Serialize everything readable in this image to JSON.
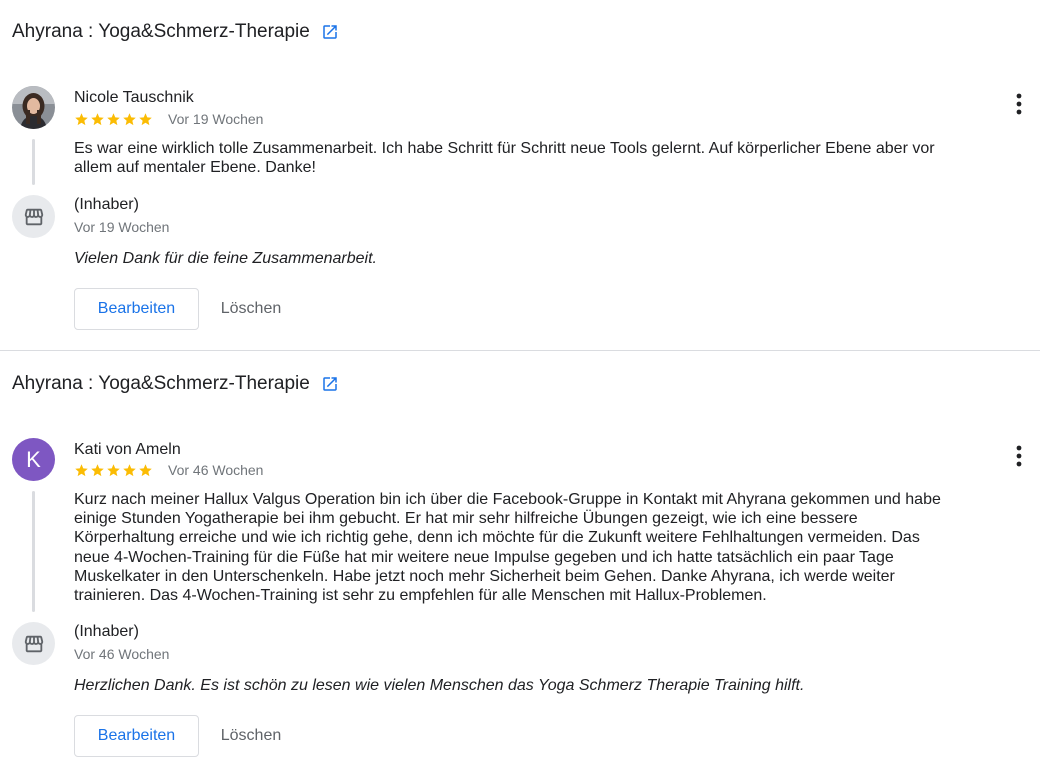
{
  "reviews": [
    {
      "business_title": "Ahyrana : Yoga&Schmerz-Therapie",
      "reviewer_name": "Nicole Tauschnik",
      "avatar_letter": "",
      "rating": 5,
      "date": "Vor 19 Wochen",
      "text": "Es war eine wirklich tolle Zusammenarbeit. Ich habe Schritt für Schritt neue Tools gelernt. Auf körperlicher Ebene aber vor allem auf mentaler Ebene. Danke!",
      "owner_label": "(Inhaber)",
      "owner_date": "Vor 19 Wochen",
      "reply": "Vielen Dank für die feine Zusammenarbeit.",
      "edit_label": "Bearbeiten",
      "delete_label": "Löschen"
    },
    {
      "business_title": "Ahyrana : Yoga&Schmerz-Therapie",
      "reviewer_name": "Kati von Ameln",
      "avatar_letter": "K",
      "rating": 5,
      "date": "Vor 46 Wochen",
      "text": "Kurz nach meiner Hallux Valgus Operation bin ich über die Facebook-Gruppe in Kontakt mit Ahyrana gekommen und habe einige Stunden Yogatherapie bei ihm gebucht. Er hat mir sehr hilfreiche Übungen gezeigt, wie ich eine bessere Körperhaltung erreiche und wie ich richtig gehe, denn ich möchte für die Zukunft weitere Fehlhaltungen vermeiden. Das neue 4-Wochen-Training für die Füße hat mir weitere neue Impulse gegeben und ich hatte tatsächlich ein paar Tage Muskelkater in den Unterschenkeln. Habe jetzt noch mehr Sicherheit beim Gehen. Danke Ahyrana, ich werde weiter trainieren. Das 4-Wochen-Training ist sehr zu empfehlen für alle Menschen mit Hallux-Problemen.",
      "owner_label": "(Inhaber)",
      "owner_date": "Vor 46 Wochen",
      "reply": "Herzlichen Dank. Es ist schön zu lesen wie vielen Menschen das Yoga Schmerz Therapie Training hilft.",
      "edit_label": "Bearbeiten",
      "delete_label": "Löschen"
    }
  ],
  "icons": {
    "external_link": "open-in-new-icon",
    "more": "more-vert-icon",
    "store": "storefront-icon",
    "star": "star-icon"
  },
  "colors": {
    "accent_blue": "#1a73e8",
    "star_gold": "#fbbc04",
    "avatar_purple": "#7e57c2",
    "muted_text": "#70757a",
    "divider": "#dadce0"
  }
}
